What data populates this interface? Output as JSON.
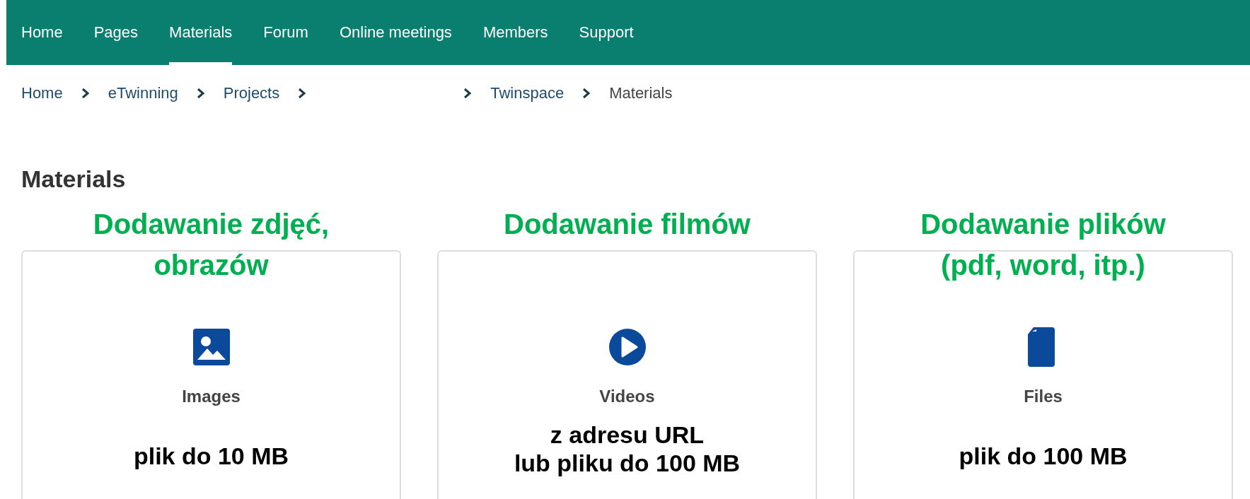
{
  "nav": {
    "items": [
      {
        "label": "Home",
        "selected": false
      },
      {
        "label": "Pages",
        "selected": false
      },
      {
        "label": "Materials",
        "selected": true
      },
      {
        "label": "Forum",
        "selected": false
      },
      {
        "label": "Online meetings",
        "selected": false
      },
      {
        "label": "Members",
        "selected": false
      },
      {
        "label": "Support",
        "selected": false
      }
    ]
  },
  "breadcrumb": {
    "items": [
      {
        "label": "Home",
        "kind": "link",
        "hidden_before": false
      },
      {
        "label": "eTwinning",
        "kind": "link",
        "hidden_before": false
      },
      {
        "label": "Projects",
        "kind": "link",
        "hidden_before": false
      },
      {
        "label": "Twinspace",
        "kind": "link",
        "hidden_before": true
      },
      {
        "label": "Materials",
        "kind": "current",
        "hidden_before": false
      }
    ]
  },
  "heading": "Materials",
  "cards": [
    {
      "kind": "image",
      "annotation": [
        "Dodawanie zdjęć,",
        "obrazów"
      ],
      "label": "Images",
      "note": [
        "plik do 10 MB"
      ]
    },
    {
      "kind": "video",
      "annotation": [
        "Dodawanie filmów"
      ],
      "label": "Videos",
      "note": [
        "z adresu URL",
        "lub pliku do 100 MB"
      ]
    },
    {
      "kind": "file",
      "annotation": [
        "Dodawanie plików",
        "(pdf, word, itp.)"
      ],
      "label": "Files",
      "note": [
        "plik do 100 MB"
      ]
    }
  ]
}
